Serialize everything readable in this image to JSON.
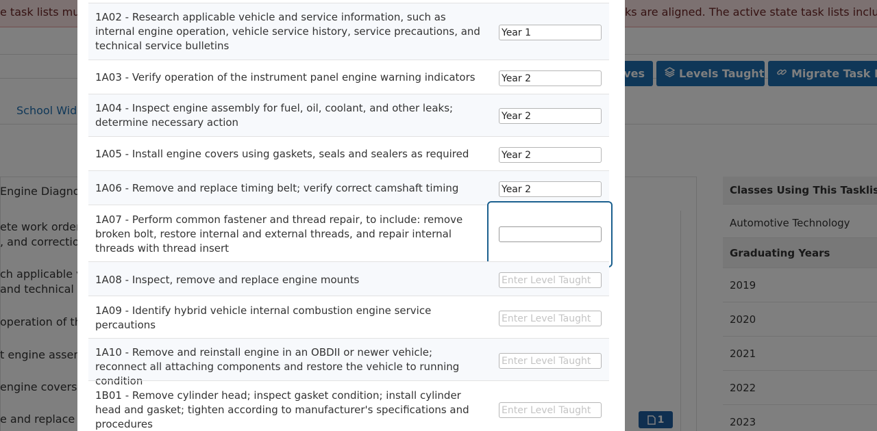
{
  "background": {
    "alert_left": "e task lists mus",
    "alert_right": "ks are aligned. The active state task lists includ",
    "buttons": [
      {
        "icon": "",
        "label": "ves"
      },
      {
        "icon": "layers-icon",
        "label": "Levels Taught"
      },
      {
        "icon": "link-icon",
        "label": "Migrate Task Pr"
      }
    ],
    "tab": "School Wid",
    "panel_title": "Engine Diagno",
    "fragments": [
      "ete work order t",
      ", and correctio",
      "ch applicable v",
      "and technical s",
      "operation of th",
      "t engine assem",
      "engine covers",
      "e and replace"
    ],
    "badge": "1",
    "side_panel": {
      "header": "Classes Using This Tasklist",
      "class_name": "Automotive Technology",
      "years_header": "Graduating Years",
      "years": [
        "2019",
        "2020",
        "2021",
        "2022",
        "2023"
      ]
    }
  },
  "modal": {
    "placeholder": "Enter Level Taught",
    "tasks": [
      {
        "text": "1A02 - Research applicable vehicle and service information, such as internal engine operation, vehicle service history, service precautions, and technical service bulletins",
        "value": "Year 1"
      },
      {
        "text": "1A03 - Verify operation of the instrument panel engine warning indicators",
        "value": "Year 2"
      },
      {
        "text": "1A04 - Inspect engine assembly for fuel, oil, coolant, and other leaks; determine necessary action",
        "value": "Year 2"
      },
      {
        "text": "1A05 - Install engine covers using gaskets, seals and sealers as required",
        "value": "Year 2"
      },
      {
        "text": "1A06 - Remove and replace timing belt; verify correct camshaft timing",
        "value": "Year 2"
      },
      {
        "text": "1A07 - Perform common fastener and thread repair, to include: remove broken bolt, restore internal and external threads, and repair internal threads with thread insert",
        "value": ""
      },
      {
        "text": "1A08 - Inspect, remove and replace engine mounts",
        "value": ""
      },
      {
        "text": "1A09 - Identify hybrid vehicle internal combustion engine service percautions",
        "value": ""
      },
      {
        "text": "1A10 - Remove and reinstall engine in an OBDII or newer vehicle; reconnect all attaching components and restore the vehicle to running condition",
        "value": ""
      },
      {
        "text": "1B01 - Remove cylinder head; inspect gasket condition; install cylinder head and gasket; tighten according to manufacturer's specifications and procedures",
        "value": ""
      }
    ]
  }
}
